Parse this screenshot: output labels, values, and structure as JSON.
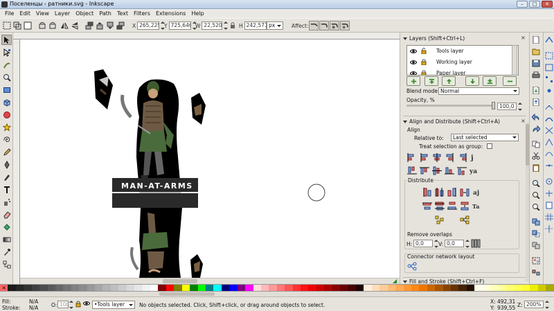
{
  "window": {
    "title": "Поселенцы - ратники.svg - Inkscape",
    "btn_min": "–",
    "btn_max": "□",
    "btn_close": "✕"
  },
  "menu": [
    "File",
    "Edit",
    "View",
    "Layer",
    "Object",
    "Path",
    "Text",
    "Filters",
    "Extensions",
    "Help"
  ],
  "controls": {
    "x_label": "X",
    "x_value": "265,225",
    "y_label": "Y",
    "y_value": "725,646",
    "w_label": "W",
    "w_value": "22,520",
    "h_label": "H",
    "h_value": "242,571",
    "unit": "px",
    "affect_label": "Affect:"
  },
  "artwork": {
    "banner_text": "MAN-AT-ARMS"
  },
  "layers_panel": {
    "title": "Layers (Shift+Ctrl+L)",
    "layers": [
      {
        "name": "Tools layer"
      },
      {
        "name": "Working layer"
      },
      {
        "name": "Paper layer"
      }
    ],
    "blend_label": "Blend mode:",
    "blend_value": "Normal",
    "opacity_label": "Opacity, %",
    "opacity_value": "100,0"
  },
  "align_panel": {
    "title": "Align and Distribute (Shift+Ctrl+A)",
    "align_section": "Align",
    "relative_label": "Relative to:",
    "relative_value": "Last selected",
    "treat_group_label": "Treat selection as group:",
    "distribute_section": "Distribute",
    "remove_overlaps_section": "Remove overlaps",
    "h_label": "H:",
    "h_value": "0,0",
    "v_label": "V:",
    "v_value": "0,0",
    "connector_section": "Connector network layout"
  },
  "fill_stroke_panel": {
    "title": "Fill and Stroke (Shift+Ctrl+F)"
  },
  "palette": {
    "colors": [
      "#ff3f3f",
      "#1a1a1a",
      "#262626",
      "#333333",
      "#404040",
      "#4d4d4d",
      "#595959",
      "#666666",
      "#737373",
      "#808080",
      "#8c8c8c",
      "#999999",
      "#a6a6a6",
      "#b3b3b3",
      "#bfbfbf",
      "#cccccc",
      "#d9d9d9",
      "#e6e6e6",
      "#f2f2f2",
      "#ffffff",
      "#800000",
      "#ff0000",
      "#808000",
      "#ffff00",
      "#008000",
      "#00ff00",
      "#008080",
      "#00ffff",
      "#000080",
      "#0000ff",
      "#800080",
      "#ff00ff",
      "#ffdddd",
      "#ffbbbb",
      "#ff9999",
      "#ff7777",
      "#ff5555",
      "#ff3333",
      "#ff1111",
      "#ee0000",
      "#cc0000",
      "#aa0000",
      "#880000",
      "#660000",
      "#440000",
      "#220000",
      "#ffeedd",
      "#ffddbb",
      "#ffcc99",
      "#ffbb77",
      "#ffaa55",
      "#ff9933",
      "#ff8811",
      "#ee7700",
      "#cc6600",
      "#aa5500",
      "#884400",
      "#663300",
      "#442200",
      "#221100",
      "#ffffee",
      "#ffffdd",
      "#ffffbb",
      "#ffff99",
      "#ffff77",
      "#ffff55",
      "#ffff33",
      "#eeee00",
      "#cccc00",
      "#aaaa00"
    ]
  },
  "status": {
    "fill_label": "Fill:",
    "fill_value": "N/A",
    "stroke_label": "Stroke:",
    "stroke_value": "N/A",
    "opacity_label": "O:",
    "opacity_value": "100",
    "layer_value": "•Tools layer",
    "message": "No objects selected. Click, Shift+click, or drag around objects to select.",
    "x_label": "X:",
    "x_value": "492,31",
    "y_label": "Y:",
    "y_value": "939,55",
    "zoom_label": "Z:",
    "zoom_value": "200%"
  },
  "colors": {
    "accent": "#3d7a2f",
    "silhouette": "#000000",
    "banner": "#2a2a2a",
    "banner_text": "#ffffff"
  }
}
